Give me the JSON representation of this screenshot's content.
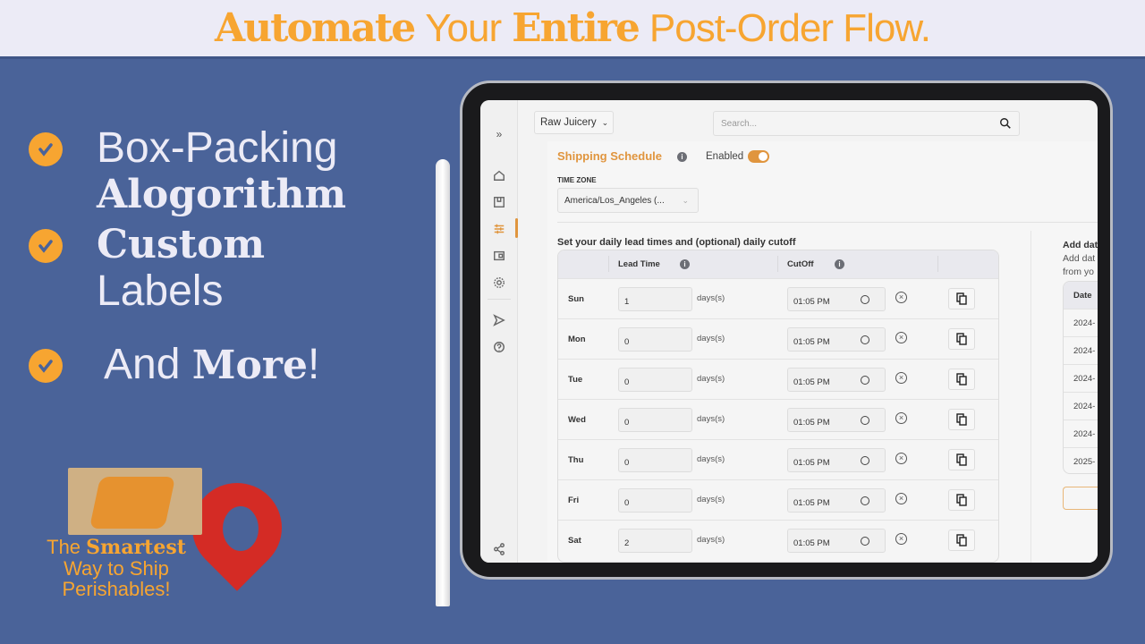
{
  "banner": {
    "w1": "Automate",
    "w2": "Your",
    "w3": "Entire",
    "w4": "Post-Order Flow."
  },
  "features": [
    {
      "line1": "Box-Packing",
      "line2": "Alogorithm"
    },
    {
      "line1": "Custom",
      "line2": "Labels"
    },
    {
      "pre": "And ",
      "bold": "More",
      "post": "!"
    }
  ],
  "promo": {
    "the": "The ",
    "smartest": "Smartest",
    "line2": "Way to Ship",
    "line3": "Perishables!"
  },
  "app": {
    "store_select": "Raw Juicery",
    "search_placeholder": "Search...",
    "title": "Shipping Schedule",
    "enabled_label": "Enabled",
    "enabled": true,
    "timezone_label": "TIME ZONE",
    "timezone_value": "America/Los_Angeles (...",
    "lead_subtitle": "Set your daily lead times and (optional) daily cutoff",
    "columns": {
      "lead": "Lead Time",
      "cutoff": "CutOff"
    },
    "unit": "days(s)",
    "rows": [
      {
        "day": "Sun",
        "lead": "1",
        "cutoff": "01:05 PM"
      },
      {
        "day": "Mon",
        "lead": "0",
        "cutoff": "01:05 PM"
      },
      {
        "day": "Tue",
        "lead": "0",
        "cutoff": "01:05 PM"
      },
      {
        "day": "Wed",
        "lead": "0",
        "cutoff": "01:05 PM"
      },
      {
        "day": "Thu",
        "lead": "0",
        "cutoff": "01:05 PM"
      },
      {
        "day": "Fri",
        "lead": "0",
        "cutoff": "01:05 PM"
      },
      {
        "day": "Sat",
        "lead": "2",
        "cutoff": "01:05 PM"
      }
    ],
    "right": {
      "title": "Add dat",
      "desc1": "Add dat",
      "desc2": "from yo",
      "date_header": "Date",
      "dates": [
        "2024-",
        "2024-",
        "2024-",
        "2024-",
        "2024-",
        "2025-"
      ]
    },
    "accent": "#e0953e"
  }
}
